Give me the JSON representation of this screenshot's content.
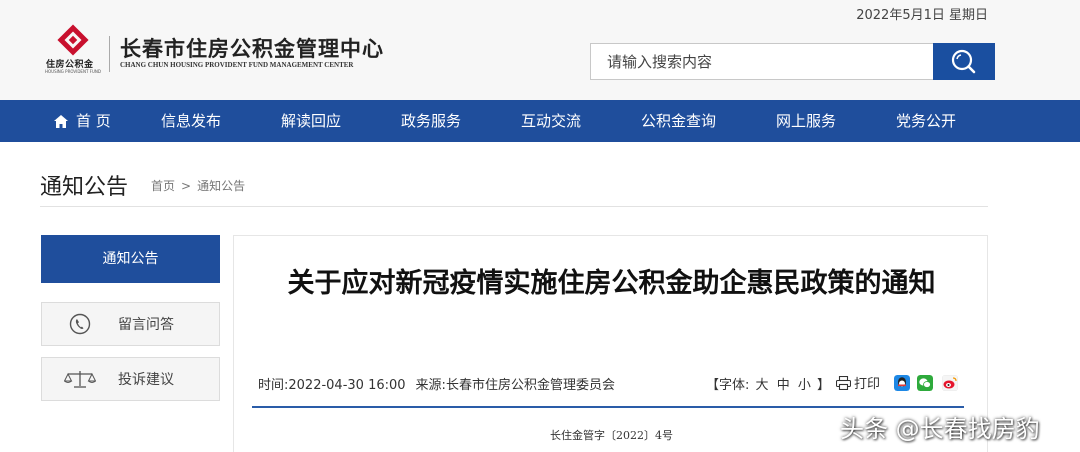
{
  "header": {
    "date": "2022年5月1日 星期日",
    "logo_small": "住房公积金",
    "logo_tiny": "HOUSING PROVIDENT FUND",
    "org_cn": "长春市住房公积金管理中心",
    "org_en": "CHANG CHUN HOUSING PROVIDENT FUND MANAGEMENT CENTER",
    "search_placeholder": "请输入搜索内容",
    "search_icon": "search-icon",
    "brand_color": "#1f4e9c",
    "logo_color": "#c8102e"
  },
  "nav": {
    "items": [
      "首 页",
      "信息发布",
      "解读回应",
      "政务服务",
      "互动交流",
      "公积金查询",
      "网上服务",
      "党务公开"
    ],
    "home_icon": "home-icon"
  },
  "breadcrumb": {
    "heading": "通知公告",
    "home": "首页",
    "separator": ">",
    "current": "通知公告"
  },
  "sidebar": {
    "active": "通知公告",
    "items": [
      {
        "label": "留言问答",
        "icon": "phone-icon"
      },
      {
        "label": "投诉建议",
        "icon": "scale-icon"
      }
    ]
  },
  "article": {
    "title": "关于应对新冠疫情实施住房公积金助企惠民政策的通知",
    "time_label": "时间:",
    "time": "2022-04-30 16:00",
    "source_label": "来源:",
    "source": "长春市住房公积金管理委员会",
    "font_label": "【字体:",
    "font_large": "大",
    "font_medium": "中",
    "font_small": "小",
    "font_close": "】",
    "print_label": "打印",
    "share_icons": [
      "qq-icon",
      "wechat-icon",
      "weibo-icon"
    ],
    "doc_number": "长住金管字〔2022〕4号"
  },
  "watermark": "头条 @长春找房豹"
}
